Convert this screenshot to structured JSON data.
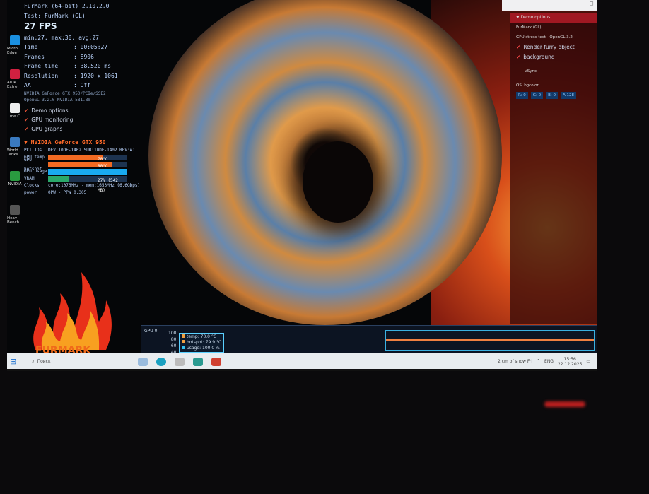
{
  "osd": {
    "line1": "FurMark (64-bit) 2.10.2.0",
    "line2": "Test: FurMark (GL)",
    "fps": "27 FPS",
    "minmax": "min:27, max:30, avg:27",
    "stats": [
      {
        "k": "Time",
        "v": ": 00:05:27"
      },
      {
        "k": "Frames",
        "v": ": 8906"
      },
      {
        "k": "Frame time",
        "v": ": 38.520 ms"
      },
      {
        "k": "Resolution",
        "v": ": 1920 x 1061"
      },
      {
        "k": "AA",
        "v": ": Off"
      }
    ],
    "gpu_line": "NVIDIA GeForce GTX 950/PCIe/SSE2",
    "gl_line": "OpenGL 3.2.0 NVIDIA 581.80",
    "options": [
      "Demo options",
      "GPU monitoring",
      "GPU graphs"
    ],
    "gpu_name": "NVIDIA GeForce GTX 950",
    "pci": {
      "k": "PCI IDs",
      "v": "DEV:10DE-1402 SUB:10DE-1402 REV:A1"
    },
    "metrics": [
      {
        "k": "GPU temp",
        "v": "70°C",
        "pct": 70,
        "color": "#f26a22"
      },
      {
        "k": "GPU hotspot",
        "v": "80°C",
        "pct": 80,
        "color": "#f26a22"
      },
      {
        "k": "GPU usage",
        "v": "",
        "pct": 100,
        "color": "#19aaf0"
      },
      {
        "k": "VRAM",
        "v": "27% (542 MB)",
        "pct": 27,
        "color": "#2aa86a"
      }
    ],
    "clocks": {
      "k": "Clocks",
      "v": "core:1076MHz - mem:1653MHz (6.6Gbps)"
    },
    "power": {
      "k": "power",
      "v": "0PW - PPW 0.305"
    }
  },
  "logo_text": "FURMARK",
  "desktop_icons": [
    "Micro Edge",
    "AIDA Extre",
    "me C",
    "World Tanks",
    "NVIDIA",
    "Heav Bench"
  ],
  "panel": {
    "header": "Demo options",
    "l1": "FurMark (GL)",
    "l2": "GPU stress test - OpenGL 3.2",
    "c1": "Render furry object",
    "c2": "background",
    "vsync": "VSync",
    "bg": "OSI bgcolor",
    "btns": [
      "R: 0",
      "G: 0",
      "B: 0",
      "A:128"
    ]
  },
  "window_close": "□",
  "graph": {
    "label": "GPU 0",
    "axis": [
      "100",
      "80",
      "60",
      "40"
    ],
    "legend": [
      {
        "t": "temp: 70.0 °C",
        "c": "#f0a040"
      },
      {
        "t": "hotspot: 79.9 °C",
        "c": "#f0a040"
      },
      {
        "t": "usage: 100.0 %",
        "c": "#30c0f0"
      }
    ]
  },
  "taskbar": {
    "search": "Поиск",
    "weather": "2 cm of snow Fri",
    "lang": "ENG",
    "time": "15:56",
    "date": "22.12.2025"
  }
}
